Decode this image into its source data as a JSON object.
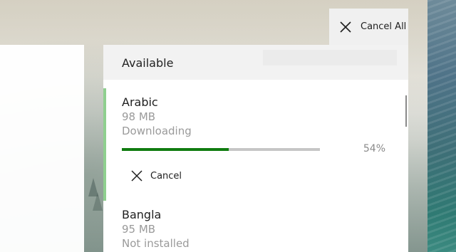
{
  "toolbar": {
    "cancel_all_label": "Cancel All",
    "cancel_all_icon": "close-icon"
  },
  "panel": {
    "title": "Available"
  },
  "languages": [
    {
      "name": "Arabic",
      "size": "98 MB",
      "status": "Downloading",
      "progress_percent": 54,
      "progress_label": "54%",
      "cancel_label": "Cancel"
    },
    {
      "name": "Bangla",
      "size": "95 MB",
      "status": "Not installed"
    }
  ],
  "colors": {
    "progress": "#107c10",
    "accent": "#8fcf8f"
  }
}
